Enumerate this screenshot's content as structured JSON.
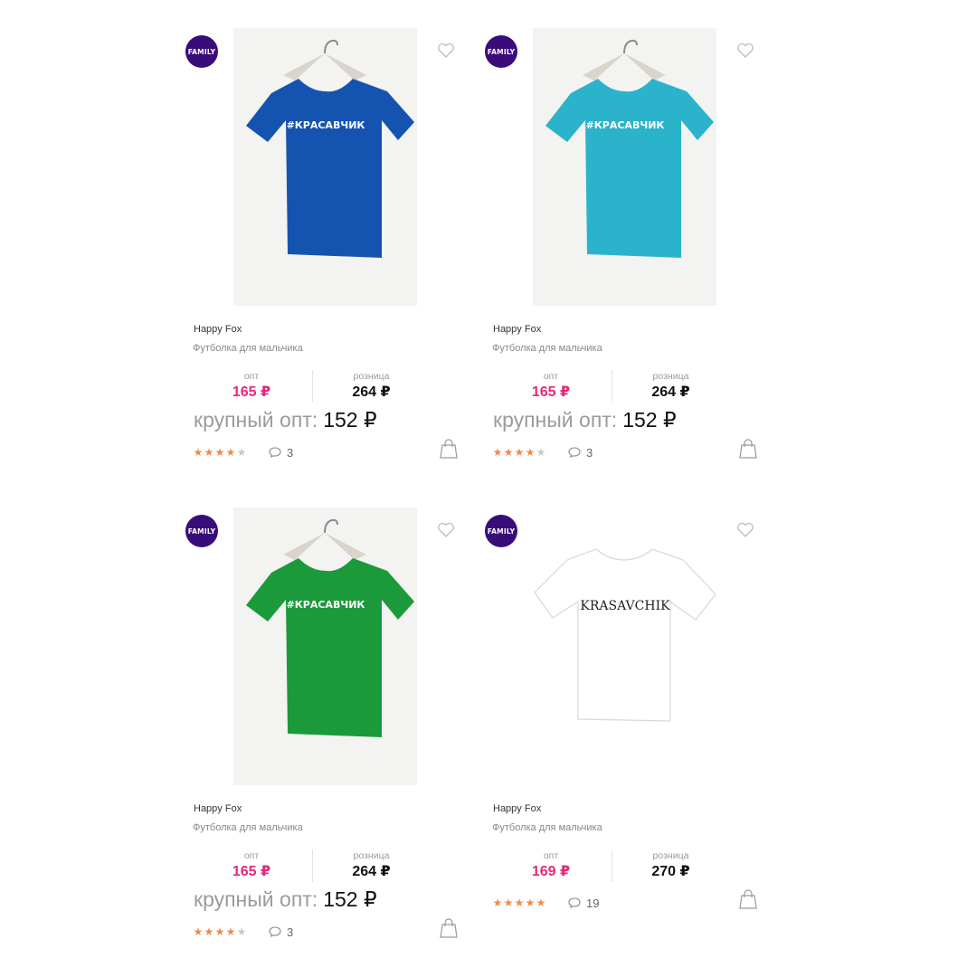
{
  "products": [
    {
      "badge": "FAMILY",
      "shirt_color": "#1454b0",
      "print": "#КРАСАВЧИК",
      "brand": "Happy Fox",
      "name": "Футболка для мальчика",
      "opt_label": "опт",
      "opt_price": "165 ₽",
      "retail_label": "розница",
      "retail_price": "264 ₽",
      "bulk_label": "крупный опт:",
      "bulk_price": "152 ₽",
      "rating": 4,
      "comments": "3"
    },
    {
      "badge": "FAMILY",
      "shirt_color": "#2bb3cc",
      "print": "#КРАСАВЧИК",
      "brand": "Happy Fox",
      "name": "Футболка для мальчика",
      "opt_label": "опт",
      "opt_price": "165 ₽",
      "retail_label": "розница",
      "retail_price": "264 ₽",
      "bulk_label": "крупный опт:",
      "bulk_price": "152 ₽",
      "rating": 4,
      "comments": "3"
    },
    {
      "badge": "FAMILY",
      "shirt_color": "#1a9a3a",
      "print": "#КРАСАВЧИК",
      "brand": "Happy Fox",
      "name": "Футболка для мальчика",
      "opt_label": "опт",
      "opt_price": "165 ₽",
      "retail_label": "розница",
      "retail_price": "264 ₽",
      "bulk_label": "крупный опт:",
      "bulk_price": "152 ₽",
      "rating": 4,
      "comments": "3"
    },
    {
      "badge": "FAMILY",
      "shirt_color": "#ffffff",
      "print": "KRASAVCHIK",
      "brand": "Happy Fox",
      "name": "Футболка для мальчика",
      "opt_label": "опт",
      "opt_price": "169 ₽",
      "retail_label": "розница",
      "retail_price": "270 ₽",
      "rating": 5,
      "comments": "19"
    }
  ],
  "colors": {
    "accent_price": "#e9267a",
    "star": "#f08a4b",
    "badge": "#3a0c7a"
  }
}
